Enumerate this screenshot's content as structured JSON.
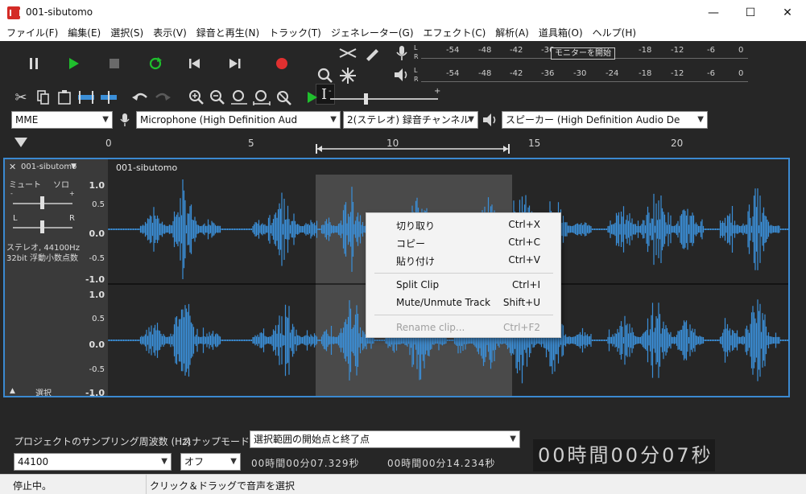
{
  "window": {
    "title": "001-sibutomo",
    "minimize": "—",
    "maximize": "☐",
    "close": "✕"
  },
  "menu": [
    "ファイル(F)",
    "編集(E)",
    "選択(S)",
    "表示(V)",
    "録音と再生(N)",
    "トラック(T)",
    "ジェネレーター(G)",
    "エフェクト(C)",
    "解析(A)",
    "道具箱(O)",
    "ヘルプ(H)"
  ],
  "transport": {
    "pause": "pause-icon",
    "play": "play-icon",
    "stop": "stop-icon",
    "loop": "loop-icon",
    "skip_start": "skip-start-icon",
    "skip_end": "skip-end-icon",
    "record": "record-icon"
  },
  "meters": {
    "ticks": [
      "-54",
      "-48",
      "-42",
      "-36",
      "-30",
      "-24",
      "-18",
      "-12",
      "-6",
      "0"
    ],
    "monitor_label": "モニターを開始",
    "lr": [
      "L",
      "R"
    ]
  },
  "devices": {
    "host": "MME",
    "mic": "Microphone (High Definition Aud",
    "channels": "2(ステレオ) 録音チャンネル",
    "speaker": "スピーカー (High Definition Audio De"
  },
  "ruler": {
    "labels": [
      "0",
      "5",
      "10",
      "15",
      "20"
    ]
  },
  "track": {
    "name": "001-sibutomo",
    "mute": "ミュート",
    "solo": "ソロ",
    "pan_l": "L",
    "pan_r": "R",
    "info1": "ステレオ, 44100Hz",
    "info2": "32bit 浮動小数点数",
    "select": "選択",
    "clip_name": "001-sibutomo",
    "scale": [
      "1.0",
      "0.5",
      "0.0",
      "-0.5",
      "-1.0"
    ]
  },
  "context_menu": {
    "items": [
      {
        "label": "切り取り",
        "key": "Ctrl+X"
      },
      {
        "label": "コピー",
        "key": "Ctrl+C"
      },
      {
        "label": "貼り付け",
        "key": "Ctrl+V"
      },
      {
        "label": "Split Clip",
        "key": "Ctrl+I"
      },
      {
        "label": "Mute/Unmute Track",
        "key": "Shift+U"
      },
      {
        "label": "Rename clip...",
        "key": "Ctrl+F2"
      }
    ]
  },
  "selection_bar": {
    "rate_label": "プロジェクトのサンプリング周波数 (Hz)",
    "rate_value": "44100",
    "snap_label": "スナップモード",
    "snap_value": "オフ",
    "mode": "選択範囲の開始点と終了点",
    "start": "00時間00分07.329秒",
    "end": "00時間00分14.234秒",
    "big_time": "00時間00分07秒"
  },
  "status": {
    "state": "停止中。",
    "hint": "クリック＆ドラッグで音声を選択"
  },
  "colors": {
    "accent": "#3b89d0",
    "play": "#1fbf2d",
    "record": "#e03030",
    "waveform": "#3b8fd8"
  }
}
